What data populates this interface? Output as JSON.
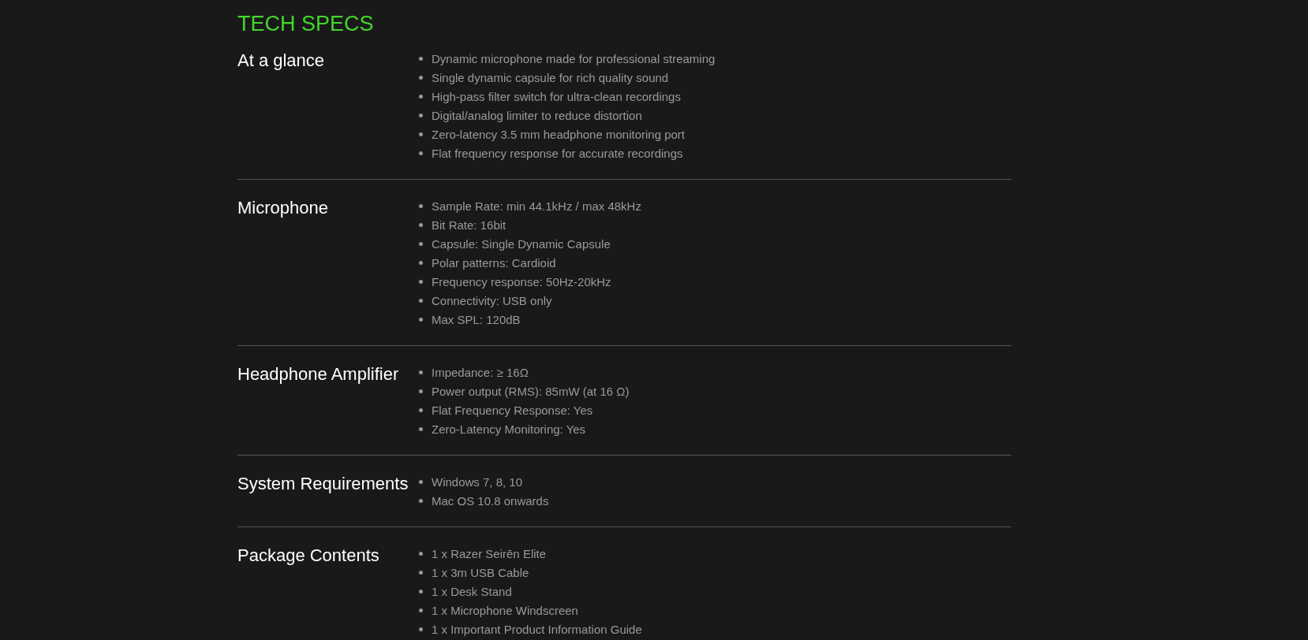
{
  "title": "TECH SPECS",
  "sections": [
    {
      "heading": "At a glance",
      "items": [
        "Dynamic microphone made for professional streaming",
        "Single dynamic capsule for rich quality sound",
        "High-pass filter switch for ultra-clean recordings",
        "Digital/analog limiter to reduce distortion",
        "Zero-latency 3.5 mm headphone monitoring port",
        "Flat frequency response for accurate recordings"
      ]
    },
    {
      "heading": "Microphone",
      "items": [
        "Sample Rate: min 44.1kHz / max 48kHz",
        "Bit Rate: 16bit",
        "Capsule: Single Dynamic Capsule",
        "Polar patterns: Cardioid",
        "Frequency response: 50Hz-20kHz",
        "Connectivity: USB only",
        "Max SPL: 120dB"
      ]
    },
    {
      "heading": "Headphone Amplifier",
      "items": [
        "Impedance: ≥ 16Ω",
        "Power output (RMS): 85mW (at 16 Ω)",
        "Flat Frequency Response: Yes",
        "Zero-Latency Monitoring: Yes"
      ]
    },
    {
      "heading": "System Requirements",
      "items": [
        "Windows 7, 8, 10",
        "Mac OS 10.8 onwards"
      ]
    },
    {
      "heading": "Package Contents",
      "items": [
        "1 x Razer Seirēn Elite",
        "1 x 3m USB Cable",
        "1 x Desk Stand",
        "1 x Microphone Windscreen",
        "1 x Important Product Information Guide"
      ]
    }
  ]
}
